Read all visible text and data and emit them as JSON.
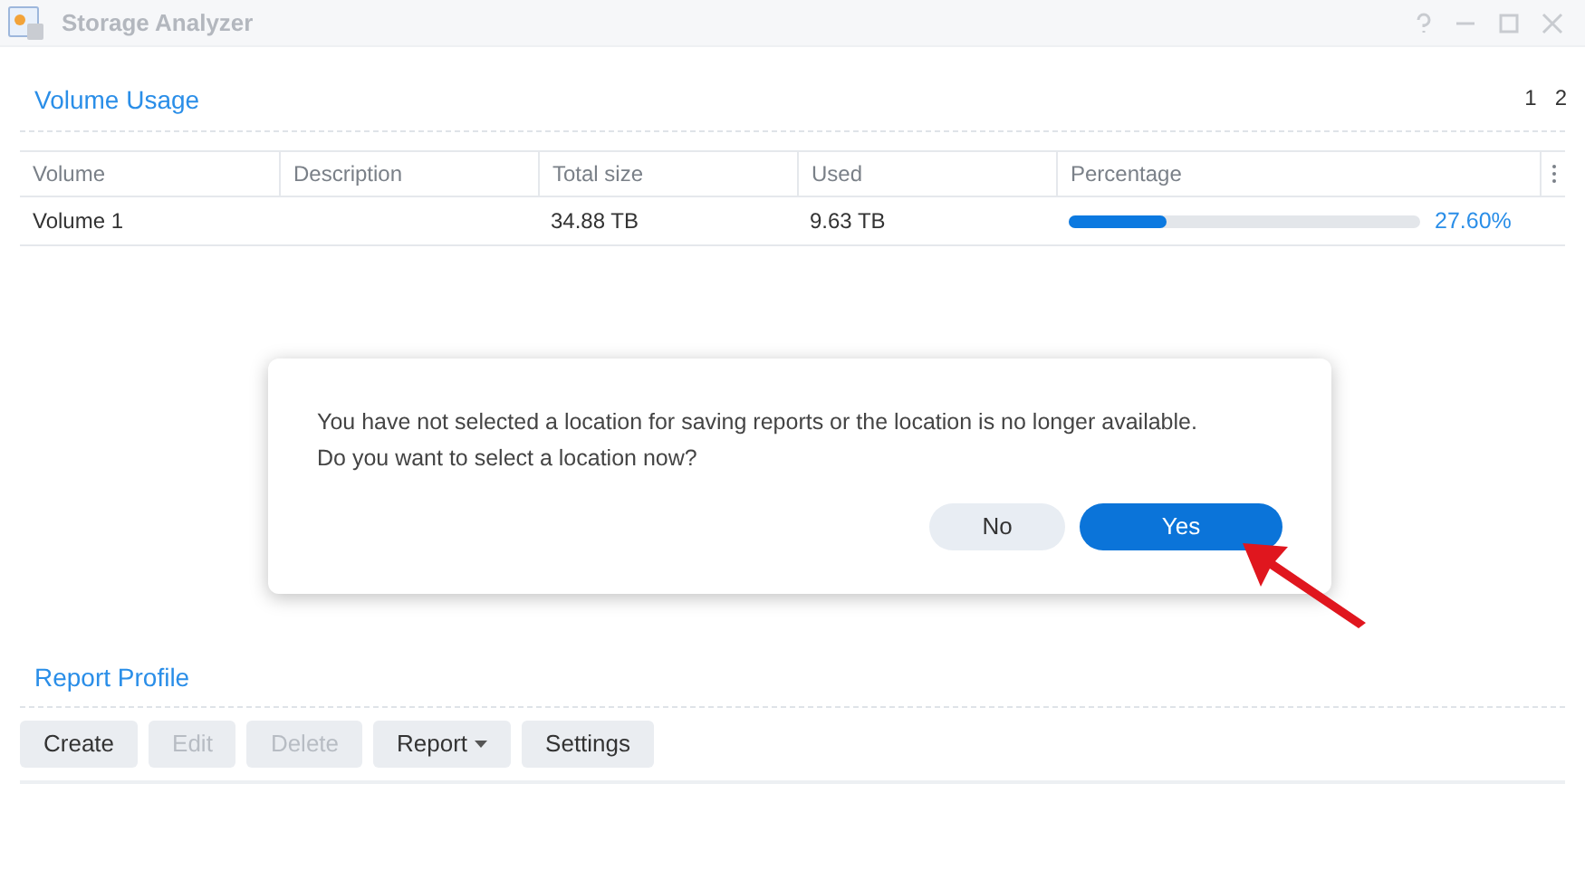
{
  "window": {
    "title": "Storage Analyzer"
  },
  "volume_usage": {
    "title": "Volume Usage",
    "pages": [
      "1",
      "2"
    ],
    "columns": [
      "Volume",
      "Description",
      "Total size",
      "Used",
      "Percentage"
    ],
    "rows": [
      {
        "volume": "Volume 1",
        "description": "",
        "total_size": "34.88 TB",
        "used": "9.63 TB",
        "level": 0.276,
        "percentage": "27.60%"
      }
    ]
  },
  "dialog": {
    "message": "You have not selected a location for saving reports or the location is no longer available. Do you want to select a location now?",
    "buttons": [
      {
        "label": "No",
        "kind": "secondary"
      },
      {
        "label": "Yes",
        "kind": "primary"
      }
    ]
  },
  "report_profile": {
    "title": "Report Profile",
    "buttons": [
      {
        "label": "Create",
        "disabled": false,
        "kind": "plain"
      },
      {
        "label": "Edit",
        "disabled": true,
        "kind": "plain"
      },
      {
        "label": "Delete",
        "disabled": true,
        "kind": "plain"
      },
      {
        "label": "Report",
        "disabled": false,
        "kind": "menu"
      },
      {
        "label": "Settings",
        "disabled": false,
        "kind": "plain"
      }
    ]
  }
}
